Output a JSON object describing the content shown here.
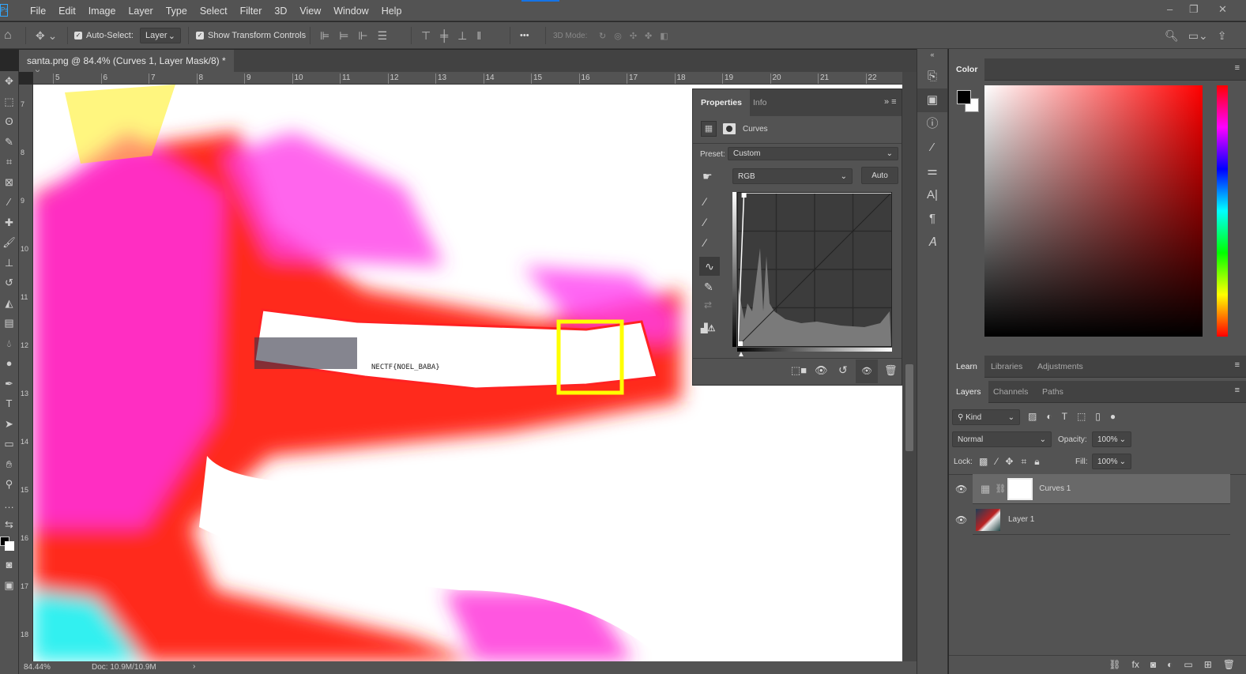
{
  "menu": {
    "logo": "Ps",
    "items": [
      "File",
      "Edit",
      "Image",
      "Layer",
      "Type",
      "Select",
      "Filter",
      "3D",
      "View",
      "Window",
      "Help"
    ]
  },
  "options": {
    "auto_select_label": "Auto-Select:",
    "auto_select_checked": true,
    "layer_select": "Layer",
    "transform_label": "Show Transform Controls",
    "transform_checked": true,
    "mode3d_label": "3D Mode:",
    "more": "•••"
  },
  "document": {
    "tab_title": "santa.png @ 84.4% (Curves 1, Layer Mask/8) *",
    "close": "×",
    "ruler_h": [
      "5",
      "6",
      "7",
      "8",
      "9",
      "10",
      "11",
      "12",
      "13",
      "14",
      "15",
      "16",
      "17",
      "18",
      "19",
      "20",
      "21",
      "22"
    ],
    "ruler_v": [
      "7",
      "8",
      "9",
      "10",
      "11",
      "12",
      "13",
      "14",
      "15",
      "16",
      "17",
      "18"
    ],
    "canvas_text": "NECTF{NOEL_BABA}"
  },
  "status": {
    "zoom": "84.44%",
    "doc": "Doc: 10.9M/10.9M"
  },
  "properties": {
    "tabs": [
      "Properties",
      "Info"
    ],
    "title": "Curves",
    "preset_label": "Preset:",
    "preset_value": "Custom",
    "channel": "RGB",
    "auto_button": "Auto",
    "curve_points": [
      [
        0,
        0
      ],
      [
        10,
        255
      ]
    ]
  },
  "color_panel": {
    "tab": "Color",
    "foreground": "#000000",
    "background": "#ffffff",
    "hue": "#ff0000"
  },
  "learn_tabs": [
    "Learn",
    "Libraries",
    "Adjustments"
  ],
  "layers_panel": {
    "tabs": [
      "Layers",
      "Channels",
      "Paths"
    ],
    "filter": "Kind",
    "blend_mode": "Normal",
    "opacity_label": "Opacity:",
    "opacity": "100%",
    "lock_label": "Lock:",
    "fill_label": "Fill:",
    "fill": "100%",
    "layers": [
      {
        "name": "Curves 1",
        "visible": true,
        "selected": true
      },
      {
        "name": "Layer 1",
        "visible": true,
        "selected": false
      }
    ]
  }
}
